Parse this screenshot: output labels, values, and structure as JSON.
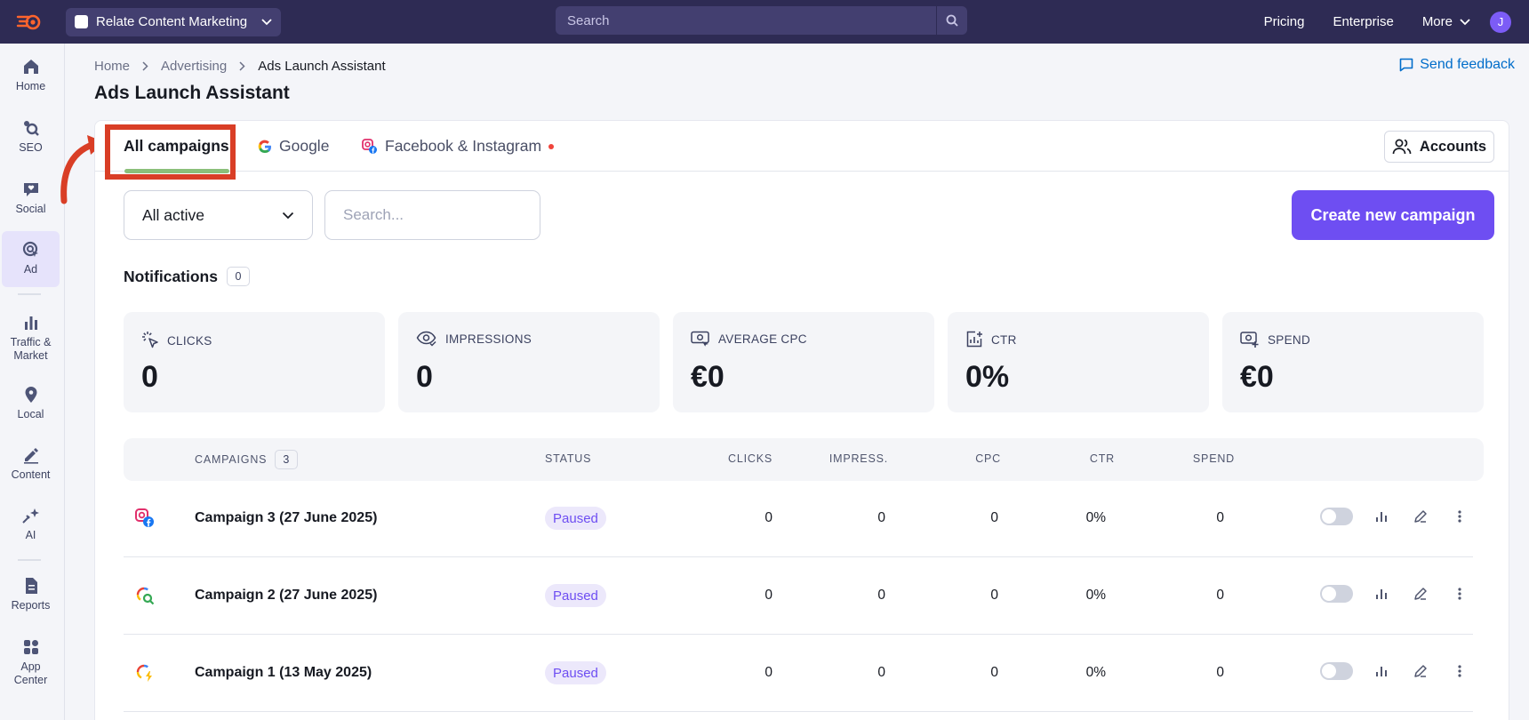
{
  "topbar": {
    "project": "Relate Content Marketing",
    "search_placeholder": "Search",
    "nav": [
      "Pricing",
      "Enterprise"
    ],
    "more": "More",
    "avatar": "J"
  },
  "sidebar": {
    "items": [
      {
        "label": "Home",
        "icon": "home-icon"
      },
      {
        "label": "SEO",
        "icon": "seo-icon"
      },
      {
        "label": "Social",
        "icon": "social-icon"
      },
      {
        "label": "Ad",
        "icon": "ad-icon"
      },
      {
        "label": "Traffic &\nMarket",
        "icon": "traffic-icon"
      },
      {
        "label": "Local",
        "icon": "pin-icon"
      },
      {
        "label": "Content",
        "icon": "pen-icon"
      },
      {
        "label": "AI",
        "icon": "sparkle-icon"
      },
      {
        "label": "Reports",
        "icon": "report-icon"
      },
      {
        "label": "App\nCenter",
        "icon": "apps-icon"
      }
    ]
  },
  "breadcrumb": [
    "Home",
    "Advertising",
    "Ads Launch Assistant"
  ],
  "feedback": "Send feedback",
  "title": "Ads Launch Assistant",
  "tabs": {
    "all": "All campaigns",
    "google": "Google",
    "facebook": "Facebook & Instagram",
    "accounts": "Accounts"
  },
  "filters": {
    "status": "All active",
    "search_placeholder": "Search...",
    "create": "Create new campaign"
  },
  "notifications": {
    "label": "Notifications",
    "count": "0"
  },
  "metrics": [
    {
      "label": "CLICKS",
      "value": "0"
    },
    {
      "label": "IMPRESSIONS",
      "value": "0"
    },
    {
      "label": "AVERAGE CPC",
      "value": "€0"
    },
    {
      "label": "CTR",
      "value": "0%"
    },
    {
      "label": "SPEND",
      "value": "€0"
    }
  ],
  "table": {
    "headers": {
      "campaigns": "CAMPAIGNS",
      "count": "3",
      "status": "STATUS",
      "clicks": "CLICKS",
      "impress": "IMPRESS.",
      "cpc": "CPC",
      "ctr": "CTR",
      "spend": "SPEND"
    },
    "rows": [
      {
        "name": "Campaign 3 (27 June 2025)",
        "status": "Paused",
        "clicks": "0",
        "impress": "0",
        "cpc": "0",
        "ctr": "0%",
        "spend": "0",
        "platform": "facebook-instagram"
      },
      {
        "name": "Campaign 2 (27 June 2025)",
        "status": "Paused",
        "clicks": "0",
        "impress": "0",
        "cpc": "0",
        "ctr": "0%",
        "spend": "0",
        "platform": "google-search"
      },
      {
        "name": "Campaign 1 (13 May 2025)",
        "status": "Paused",
        "clicks": "0",
        "impress": "0",
        "cpc": "0",
        "ctr": "0%",
        "spend": "0",
        "platform": "google-performance"
      }
    ]
  },
  "colors": {
    "accent": "#6e4ef2",
    "topbar": "#2e2b54",
    "highlight": "#d93e26",
    "tab_underline": "#8bbf7a"
  }
}
